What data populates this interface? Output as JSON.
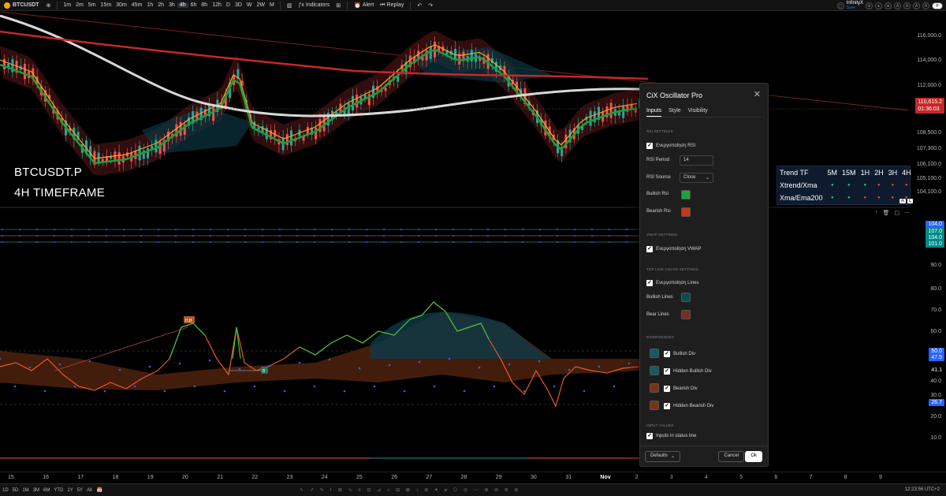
{
  "topbar": {
    "symbol": "BTCUSDT",
    "timeframes": [
      "1m",
      "2m",
      "5m",
      "15m",
      "30m",
      "45m",
      "1h",
      "2h",
      "3h",
      "4h",
      "6h",
      "8h",
      "12h",
      "D",
      "3D",
      "W",
      "2W",
      "M"
    ],
    "active_timeframe": "4h",
    "indicators_label": "Indicators",
    "alert_label": "Alert",
    "replay_label": "Replay",
    "account_name": "InfinityX",
    "account_status": "Save"
  },
  "overlay": {
    "title_line1": "BTCUSDT.P",
    "title_line2": "4H TIMEFRAME"
  },
  "trend_table": {
    "header": "Trend TF",
    "columns": [
      "5M",
      "15M",
      "1H",
      "2H",
      "3H",
      "4H"
    ],
    "rows": [
      {
        "label": "Xtrend/Xma",
        "states": [
          "g",
          "g",
          "g",
          "r",
          "r",
          "r"
        ]
      },
      {
        "label": "Xma/Ema200",
        "states": [
          "g",
          "g",
          "r",
          "r",
          "r",
          "r"
        ]
      }
    ],
    "colors": {
      "g": "#2ec27e",
      "r": "#f44336"
    }
  },
  "price_axis": {
    "labels": [
      "116,000.0",
      "114,000.0",
      "112,000.0",
      "108,500.0",
      "107,300.0",
      "106,100.0",
      "105,100.0",
      "104,100.0"
    ],
    "current_price": "110,615.2",
    "countdown": "01:36:03",
    "current_color": "#c62828"
  },
  "osc_axis": {
    "labels": [
      "90.0",
      "80.0",
      "70.0",
      "60.0",
      "40.0",
      "30.0",
      "20.0",
      "10.0"
    ],
    "top_badges": [
      "104.0",
      "107.0",
      "104.0",
      "101.0"
    ],
    "badges": [
      "50.0",
      "47.5",
      "41.1",
      "26.7"
    ]
  },
  "time_axis": {
    "labels": [
      "15",
      "16",
      "17",
      "18",
      "19",
      "20",
      "21",
      "22",
      "23",
      "24",
      "25",
      "26",
      "27",
      "28",
      "29",
      "30",
      "31",
      "Nov",
      "2",
      "3",
      "4",
      "5",
      "6",
      "7",
      "8",
      "9"
    ],
    "clock": "12:23:56 UTC+2"
  },
  "bottombar": {
    "ranges": [
      "1D",
      "5D",
      "1M",
      "3M",
      "6M",
      "YTD",
      "1Y",
      "5Y",
      "All"
    ]
  },
  "chart_labels": {
    "hb": "H,B",
    "b": "B"
  },
  "dialog": {
    "title": "CiX Oscillator Pro",
    "tabs": [
      "Inputs",
      "Style",
      "Visibility"
    ],
    "rsi_settings": "RSI SETTINGS",
    "enable_rsi": "Ενεργοποίηση RSI",
    "rsi_period_label": "RSI Period",
    "rsi_period_value": "14",
    "rsi_source_label": "RSI Source",
    "rsi_source_value": "Close",
    "bullish_rsi": "Bullish Rsi",
    "bearish_rsi": "Bearish Rsi",
    "vwap_settings": "VWAP SETTINGS",
    "enable_vwap": "Ενεργοποίηση VWAP",
    "top_line_settings": "TOP LINE COLOR SETTINGS",
    "enable_lines": "Ενεργοποίηση Lines",
    "bullish_lines": "Bullish Lines",
    "bear_lines": "Bear Lines",
    "divergences": "DIVERGENCES",
    "bullish_div": "Bullish Div",
    "hidden_bullish_div": "Hidden Bullish Div",
    "bearish_div": "Bearish Div",
    "hidden_bearish_div": "Hidden Bearish Div",
    "input_values": "INPUT VALUES",
    "inputs_in_status": "Inputs in status line",
    "defaults": "Defaults",
    "cancel": "Cancel",
    "ok": "Ok",
    "colors": {
      "bullish_rsi": "#1fa33a",
      "bearish_rsi": "#c23a1a",
      "bullish_lines": "#0f4a50",
      "bear_lines": "#7a2c20",
      "bullish_div": "#155b63",
      "hidden_bullish_div": "#155b63",
      "bearish_div": "#7a3318",
      "hidden_bearish_div": "#7a3318"
    }
  }
}
